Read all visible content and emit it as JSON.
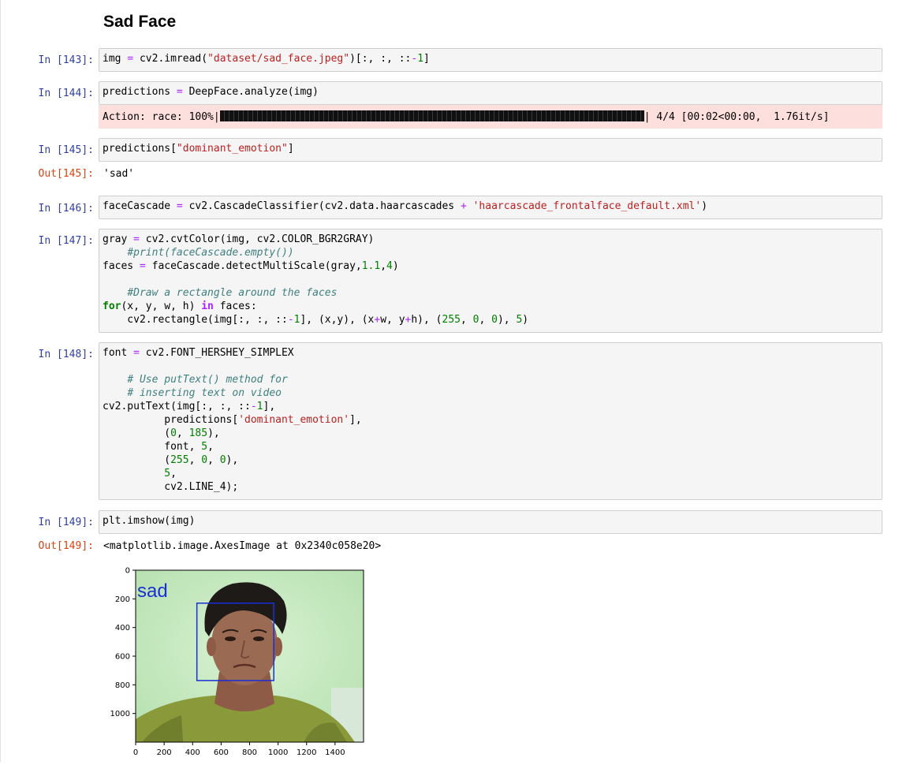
{
  "heading": "Sad Face",
  "cells": [
    {
      "prompt": "In [143]:"
    },
    {
      "prompt": "In [144]:",
      "stderr": {
        "prefix": "Action: race: 100%|",
        "suffix": "| 4/4 [00:02<00:00,  1.76it/s]",
        "progress": 1.0
      }
    },
    {
      "prompt": "In [145]:",
      "out_prompt": "Out[145]:",
      "output": "'sad'"
    },
    {
      "prompt": "In [146]:"
    },
    {
      "prompt": "In [147]:"
    },
    {
      "prompt": "In [148]:"
    },
    {
      "prompt": "In [149]:",
      "out_prompt": "Out[149]:",
      "output": "<matplotlib.image.AxesImage at 0x2340c058e20>"
    }
  ],
  "plot": {
    "overlay_text": "sad",
    "y_ticks": [
      "0",
      "200",
      "400",
      "600",
      "800",
      "1000"
    ],
    "x_ticks": [
      "0",
      "200",
      "400",
      "600",
      "800",
      "1000",
      "1200",
      "1400"
    ],
    "y_values": [
      0,
      200,
      400,
      600,
      800,
      1000
    ],
    "x_values": [
      0,
      200,
      400,
      600,
      800,
      1000,
      1200,
      1400
    ],
    "xlim": [
      0,
      1600
    ],
    "ylim": [
      1200,
      0
    ],
    "face_box": {
      "x": 430,
      "y": 230,
      "w": 540,
      "h": 540
    },
    "colors": {
      "background": "#c8ecc4",
      "box": "#1a2fd6",
      "shirt": "#8a9a3a",
      "skin": "#9b6a52",
      "hair": "#1e1a18"
    }
  }
}
